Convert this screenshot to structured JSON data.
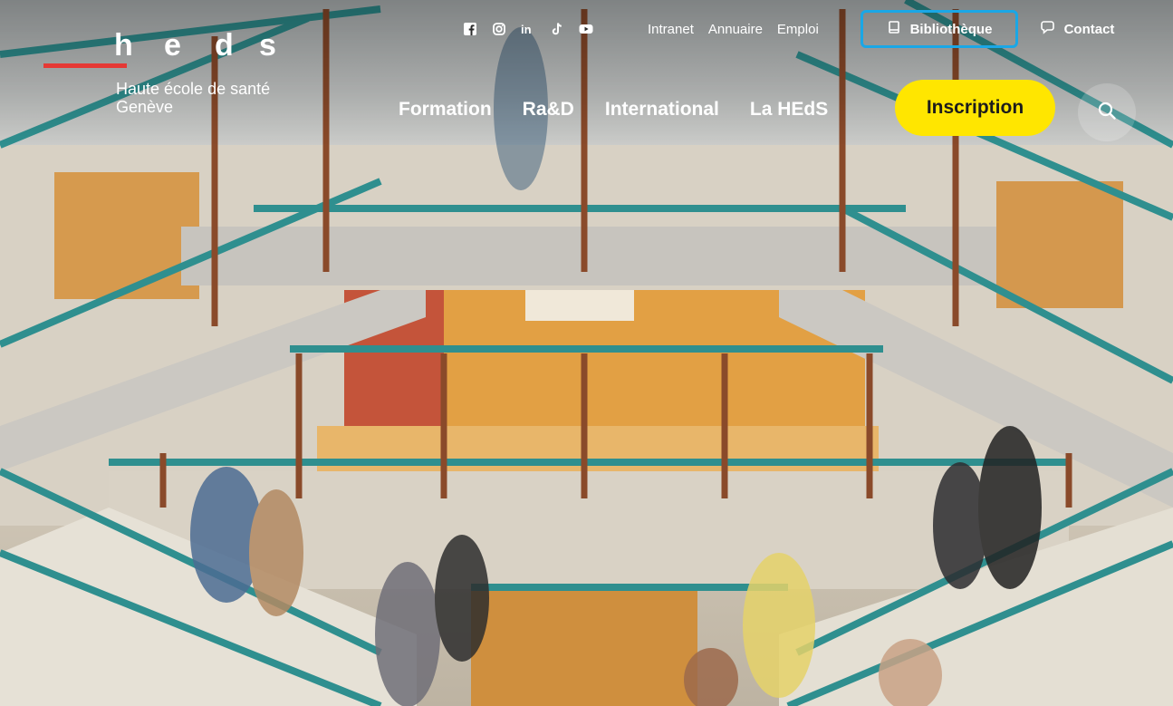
{
  "site": {
    "logo_letters": [
      "h",
      "e",
      "d",
      "s"
    ],
    "tagline_line1": "Haute école de santé",
    "tagline_line2": "Genève"
  },
  "social": [
    {
      "name": "facebook-icon"
    },
    {
      "name": "instagram-icon"
    },
    {
      "name": "linkedin-icon"
    },
    {
      "name": "tiktok-icon"
    },
    {
      "name": "youtube-icon"
    }
  ],
  "utility_nav": {
    "intranet": "Intranet",
    "annuaire": "Annuaire",
    "emploi": "Emploi",
    "bibliotheque": "Bibliothèque",
    "contact": "Contact"
  },
  "main_nav": {
    "formation": "Formation",
    "rad": "Ra&D",
    "international": "International",
    "la_heds": "La HEdS",
    "inscription": "Inscription"
  },
  "colors": {
    "accent_yellow": "#ffe600",
    "logo_red": "#e53935",
    "focus_blue": "#1aa7e6",
    "rail_teal": "#2f8f8f",
    "post_brown": "#8a4a2a"
  },
  "icons": {
    "search": "search-icon",
    "book": "book-icon",
    "contact": "chat-bubble-icon"
  }
}
